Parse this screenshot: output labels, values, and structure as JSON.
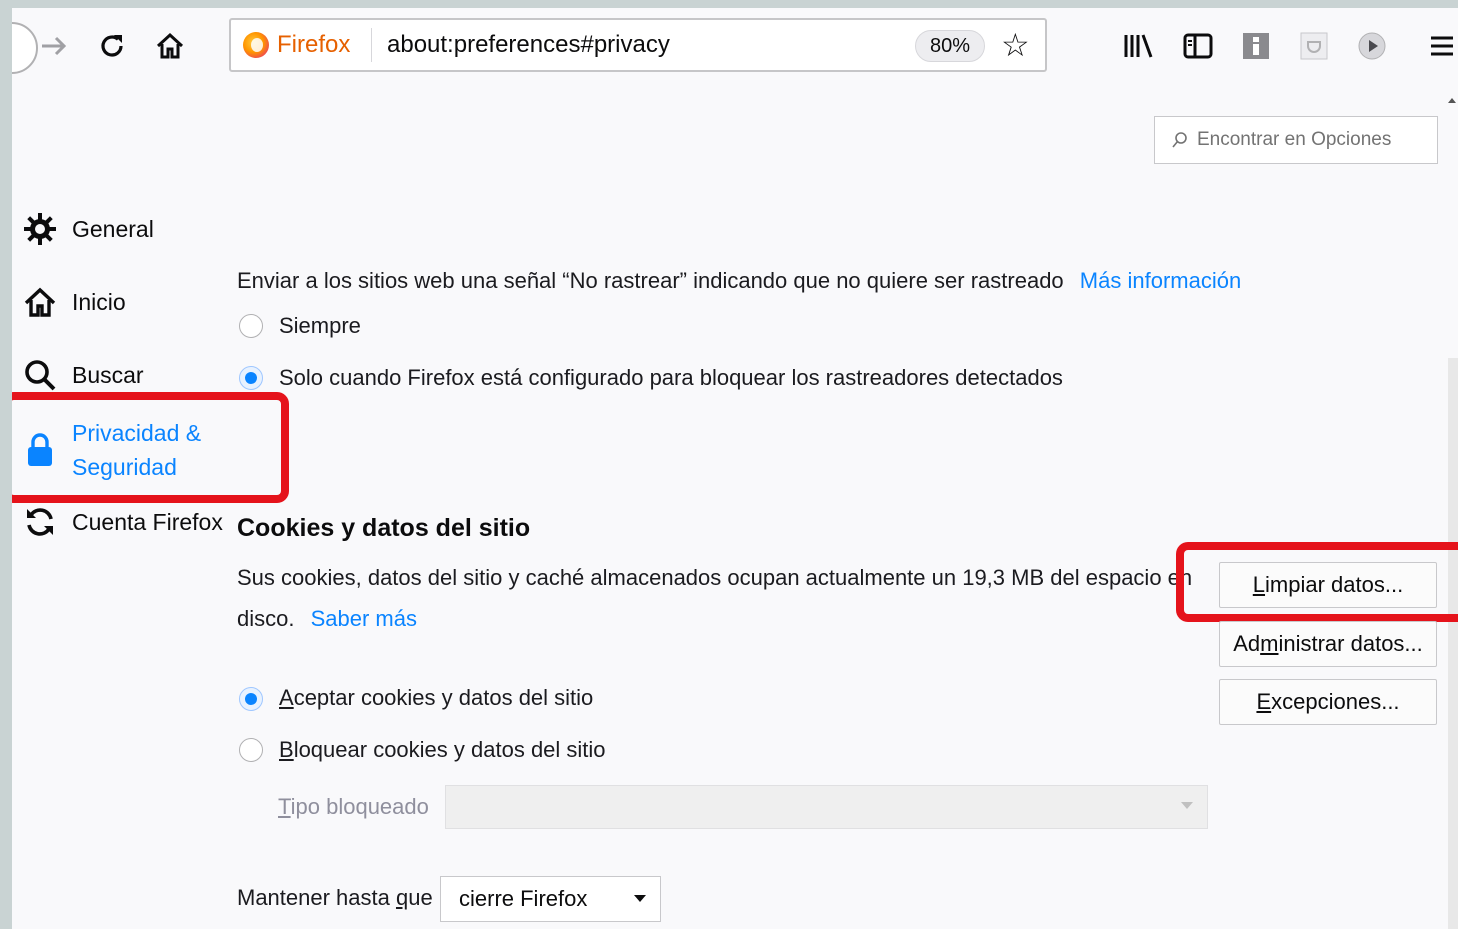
{
  "toolbar": {
    "url_brand": "Firefox",
    "url": "about:preferences#privacy",
    "zoom": "80%",
    "icons": [
      "back-icon",
      "forward-icon",
      "reload-icon",
      "home-icon",
      "bookmark-star-icon",
      "library-icon",
      "sidebar-icon",
      "extension-icon",
      "pocket-icon",
      "screenshot-icon",
      "menu-icon"
    ]
  },
  "search": {
    "placeholder": "Encontrar en Opciones"
  },
  "sidebar": {
    "items": [
      {
        "label": "General",
        "icon": "gear-icon"
      },
      {
        "label": "Inicio",
        "icon": "home-icon"
      },
      {
        "label": "Buscar",
        "icon": "search-icon"
      },
      {
        "label_line1": "Privacidad &",
        "label_line2": "Seguridad",
        "icon": "lock-icon",
        "selected": true
      },
      {
        "label": "Cuenta Firefox",
        "icon": "sync-icon"
      }
    ]
  },
  "dnt": {
    "text": "Enviar a los sitios web una señal “No rastrear” indicando que no quiere ser rastreado",
    "link": "Más información",
    "options": [
      {
        "label": "Siempre",
        "checked": false
      },
      {
        "label": "Solo cuando Firefox está configurado para bloquear los rastreadores detectados",
        "checked": true
      }
    ]
  },
  "cookies": {
    "heading": "Cookies y datos del sitio",
    "desc_line1": "Sus cookies, datos del sitio y caché almacenados ocupan actualmente un 19,3 MB del espacio en",
    "desc_line2": "disco.",
    "link": "Saber más",
    "buttons": {
      "clear_key": "L",
      "clear_rest": "impiar datos...",
      "manage_pre": "Ad",
      "manage_key": "m",
      "manage_rest": "inistrar datos...",
      "exceptions_key": "E",
      "exceptions_rest": "xcepciones..."
    },
    "accept_key": "A",
    "accept_rest": "ceptar cookies y datos del sitio",
    "block_key": "B",
    "block_rest": "loquear cookies y datos del sitio",
    "blocked_type_key": "T",
    "blocked_type_rest": "ipo bloqueado",
    "keep_pre": "Mantener hasta ",
    "keep_key": "q",
    "keep_rest": "ue",
    "keep_value": "cierre Firefox"
  },
  "colors": {
    "accent": "#0a84ff",
    "highlight": "#e5131b"
  }
}
